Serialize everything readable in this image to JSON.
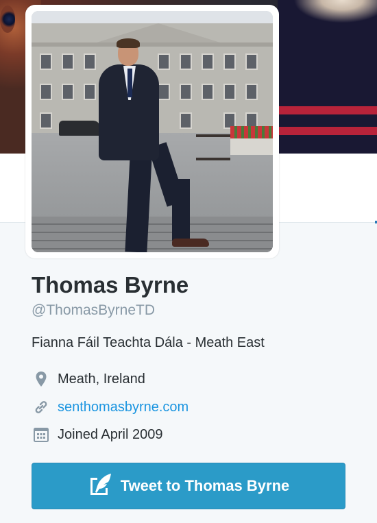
{
  "profile": {
    "name": "Thomas Byrne",
    "handle": "@ThomasByrneTD",
    "bio": "Fianna Fáil Teachta Dála - Meath East",
    "location": "Meath, Ireland",
    "website": "senthomasbyrne.com",
    "joined": "Joined April 2009"
  },
  "actions": {
    "tweet_to_label": "Tweet to Thomas Byrne"
  },
  "icons": {
    "location": "map-pin-icon",
    "website": "link-icon",
    "joined": "calendar-icon",
    "tweet": "compose-quill-icon"
  },
  "colors": {
    "accent_link": "#1b95e0",
    "button_bg": "#2b9bc8",
    "handle_gray": "#8899a6",
    "name_text": "#292f33"
  }
}
